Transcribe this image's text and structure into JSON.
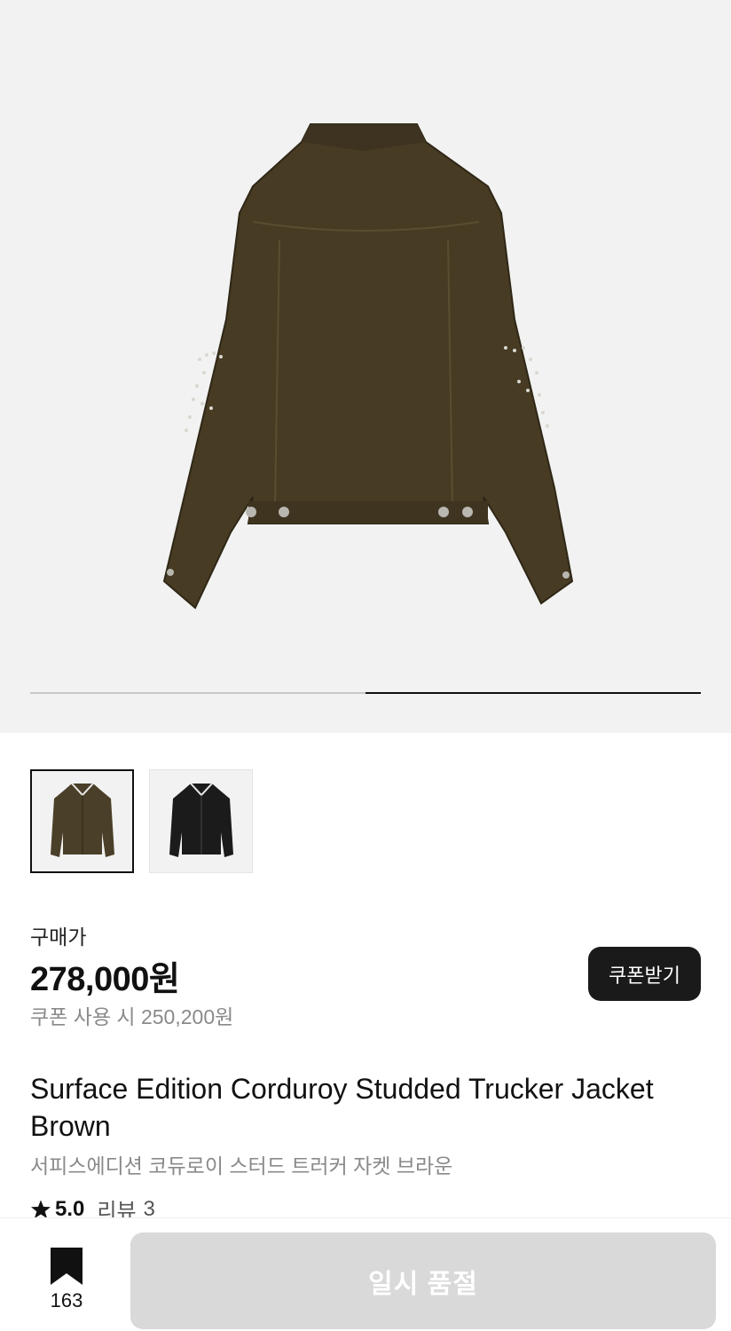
{
  "gallery": {
    "progress_fraction": 0.5,
    "active_segment": 2,
    "thumbnails": [
      {
        "color": "#4a3f28",
        "selected": true
      },
      {
        "color": "#1b1b1b",
        "selected": false
      }
    ]
  },
  "pricing": {
    "label": "구매가",
    "price": "278,000원",
    "coupon_price": "쿠폰 사용 시 250,200원",
    "coupon_button": "쿠폰받기"
  },
  "product": {
    "title": "Surface Edition Corduroy Studded Trucker Jacket Brown",
    "subtitle": "서피스에디션 코듀로이 스터드 트러커 자켓 브라운",
    "rating": "5.0",
    "review_label": "리뷰",
    "review_count": "3"
  },
  "actions": {
    "bookmark_count": "163",
    "buy_button": "일시 품절"
  },
  "colors": {
    "jacket": "#473b24",
    "accent_dark": "#1a1a1a",
    "disabled": "#d9d9d9"
  }
}
